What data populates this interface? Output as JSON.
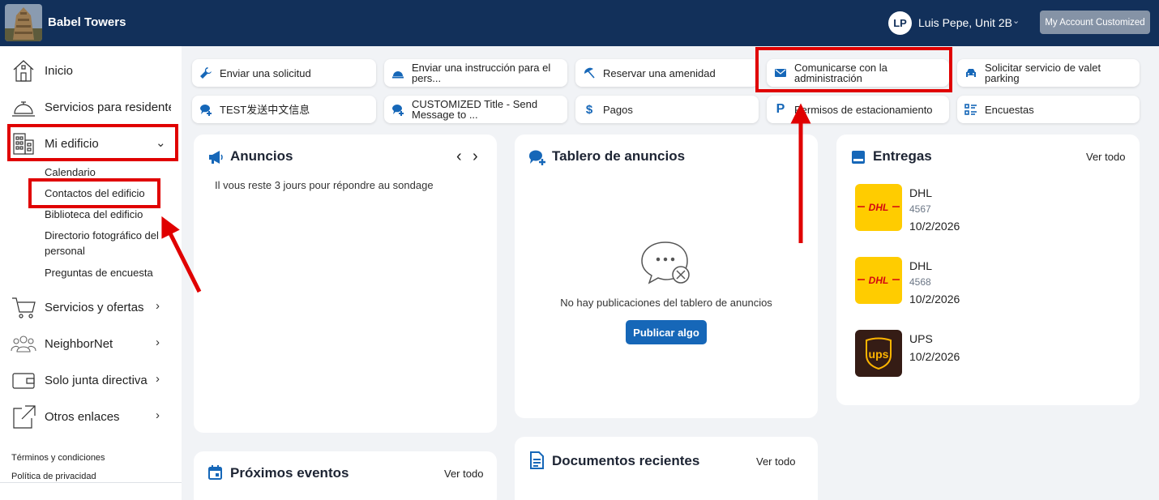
{
  "header": {
    "brand": "Babel Towers",
    "avatar_initials": "LP",
    "user_name": "Luis Pepe, Unit 2B",
    "account_button": "My Account Customized",
    "bg_color": "#12305a"
  },
  "sidebar": {
    "items": [
      {
        "label": "Inicio",
        "icon": "home-icon"
      },
      {
        "label": "Servicios para residentes",
        "icon": "concierge-bell-icon"
      },
      {
        "label": "Mi edificio",
        "icon": "building-icon"
      },
      {
        "label": "Servicios y ofertas",
        "icon": "cart-icon"
      },
      {
        "label": "NeighborNet",
        "icon": "people-icon"
      },
      {
        "label": "Solo junta directiva",
        "icon": "wallet-icon"
      },
      {
        "label": "Otros enlaces",
        "icon": "external-link-icon"
      }
    ],
    "sub_items": [
      "Calendario",
      "Contactos del edificio",
      "Biblioteca del edificio",
      "Directorio fotográfico del personal",
      "Preguntas de encuesta"
    ],
    "footer": {
      "terms": "Términos y condiciones",
      "privacy": "Política de privacidad"
    }
  },
  "quick_actions": [
    {
      "label": "Enviar una solicitud",
      "icon": "wrench-icon"
    },
    {
      "label": "Enviar una instrucción para el pers...",
      "icon": "cloche-icon"
    },
    {
      "label": "Reservar una amenidad",
      "icon": "umbrella-icon"
    },
    {
      "label": "Comunicarse con la administración",
      "icon": "envelope-icon"
    },
    {
      "label": "Solicitar servicio de valet parking",
      "icon": "car-icon"
    },
    {
      "label": "TEST发送中文信息",
      "icon": "chat-add-icon"
    },
    {
      "label": "CUSTOMIZED Title - Send Message to ...",
      "icon": "chat-add-icon"
    },
    {
      "label": "Pagos",
      "icon": "dollar-icon"
    },
    {
      "label": "Permisos de estacionamiento",
      "icon": "parking-icon"
    },
    {
      "label": "Encuestas",
      "icon": "checklist-icon"
    }
  ],
  "announcements": {
    "title": "Anuncios",
    "text": "Il vous reste 3 jours pour répondre au sondage"
  },
  "board": {
    "title": "Tablero de anuncios",
    "empty": "No hay publicaciones del tablero de anuncios",
    "button": "Publicar algo"
  },
  "deliveries": {
    "title": "Entregas",
    "link": "Ver todo",
    "items": [
      {
        "carrier": "DHL",
        "tracking": "4567",
        "date": "10/2/2026"
      },
      {
        "carrier": "DHL",
        "tracking": "4568",
        "date": "10/2/2026"
      },
      {
        "carrier": "UPS",
        "date": "10/2/2026"
      }
    ]
  },
  "events": {
    "title": "Próximos eventos",
    "link": "Ver todo"
  },
  "documents": {
    "title": "Documentos recientes",
    "link": "Ver todo"
  },
  "colors": {
    "accent": "#1667b8",
    "highlight": "#e00000",
    "dhl_yellow": "#ffcc00",
    "dhl_red": "#d40511",
    "ups_brown": "#351c15"
  }
}
